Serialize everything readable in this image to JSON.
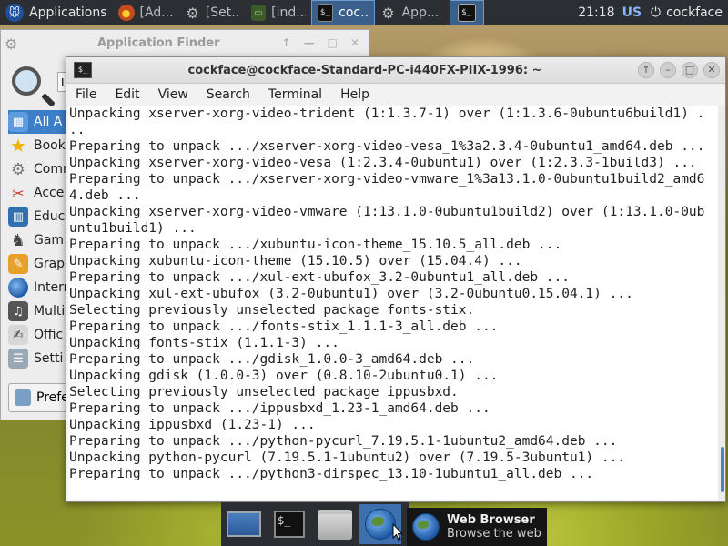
{
  "top_panel": {
    "applications_label": "Applications",
    "tasks": [
      {
        "label": "[Ad...",
        "icon": "firefox-icon"
      },
      {
        "label": "[Set...",
        "icon": "gear-icon"
      },
      {
        "label": "[ind...",
        "icon": "monitor-icon"
      },
      {
        "label": "coc...",
        "icon": "terminal-icon"
      },
      {
        "label": "App...",
        "icon": "gear-icon"
      }
    ],
    "clock": "21:18",
    "keyboard_layout": "US",
    "user": "cockface"
  },
  "app_finder": {
    "title": "Application Finder",
    "search_value": "",
    "categories": [
      {
        "label": "All Applications",
        "visible_text": "All A",
        "icon": "all-apps-icon",
        "selected": true
      },
      {
        "label": "Bookmarks",
        "visible_text": "Book",
        "icon": "star-icon"
      },
      {
        "label": "Command History",
        "visible_text": "Comm",
        "icon": "gears-icon"
      },
      {
        "label": "Accessories",
        "visible_text": "Acce",
        "icon": "accessories-icon"
      },
      {
        "label": "Education",
        "visible_text": "Educ",
        "icon": "education-icon"
      },
      {
        "label": "Games",
        "visible_text": "Gam",
        "icon": "games-icon"
      },
      {
        "label": "Graphics",
        "visible_text": "Grap",
        "icon": "graphics-icon"
      },
      {
        "label": "Internet",
        "visible_text": "Intern",
        "icon": "globe-icon"
      },
      {
        "label": "Multimedia",
        "visible_text": "Multi",
        "icon": "multimedia-icon"
      },
      {
        "label": "Office",
        "visible_text": "Offic",
        "icon": "office-icon"
      },
      {
        "label": "Settings",
        "visible_text": "Setti",
        "icon": "settings-icon"
      }
    ],
    "preferences_label": "Prefe"
  },
  "terminal": {
    "title": "cockface@cockface-Standard-PC-i440FX-PIIX-1996: ~",
    "menu": [
      "File",
      "Edit",
      "View",
      "Search",
      "Terminal",
      "Help"
    ],
    "lines": [
      "Unpacking xserver-xorg-video-trident (1:1.3.7-1) over (1:1.3.6-0ubuntu6build1) .",
      "..",
      "Preparing to unpack .../xserver-xorg-video-vesa_1%3a2.3.4-0ubuntu1_amd64.deb ...",
      "Unpacking xserver-xorg-video-vesa (1:2.3.4-0ubuntu1) over (1:2.3.3-1build3) ...",
      "Preparing to unpack .../xserver-xorg-video-vmware_1%3a13.1.0-0ubuntu1build2_amd6",
      "4.deb ...",
      "Unpacking xserver-xorg-video-vmware (1:13.1.0-0ubuntu1build2) over (1:13.1.0-0ub",
      "untu1build1) ...",
      "Preparing to unpack .../xubuntu-icon-theme_15.10.5_all.deb ...",
      "Unpacking xubuntu-icon-theme (15.10.5) over (15.04.4) ...",
      "Preparing to unpack .../xul-ext-ubufox_3.2-0ubuntu1_all.deb ...",
      "Unpacking xul-ext-ubufox (3.2-0ubuntu1) over (3.2-0ubuntu0.15.04.1) ...",
      "Selecting previously unselected package fonts-stix.",
      "Preparing to unpack .../fonts-stix_1.1.1-3_all.deb ...",
      "Unpacking fonts-stix (1.1.1-3) ...",
      "Preparing to unpack .../gdisk_1.0.0-3_amd64.deb ...",
      "Unpacking gdisk (1.0.0-3) over (0.8.10-2ubuntu0.1) ...",
      "Selecting previously unselected package ippusbxd.",
      "Preparing to unpack .../ippusbxd_1.23-1_amd64.deb ...",
      "Unpacking ippusbxd (1.23-1) ...",
      "Preparing to unpack .../python-pycurl_7.19.5.1-1ubuntu2_amd64.deb ...",
      "Unpacking python-pycurl (7.19.5.1-1ubuntu2) over (7.19.5-3ubuntu1) ...",
      "Preparing to unpack .../python3-dirspec_13.10-1ubuntu1_all.deb ..."
    ]
  },
  "dock": {
    "items": [
      {
        "name": "show-desktop",
        "icon": "desktop-icon"
      },
      {
        "name": "terminal",
        "icon": "terminal-icon"
      },
      {
        "name": "file-manager",
        "icon": "folder-icon"
      },
      {
        "name": "web-browser",
        "icon": "globe-icon"
      }
    ]
  },
  "tooltip": {
    "title": "Web Browser",
    "subtitle": "Browse the web"
  },
  "colors": {
    "panel_bg": "#2b2e33",
    "selection": "#3d7ec9",
    "terminal_bg": "#ffffff",
    "terminal_fg": "#222222"
  }
}
